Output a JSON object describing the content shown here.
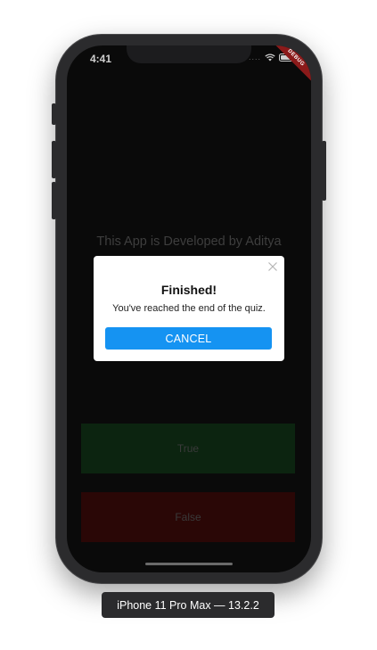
{
  "status_bar": {
    "time": "4:41",
    "signal": "....",
    "debug_banner": "DEBUG"
  },
  "app": {
    "credit_text": "This App is Developed by Aditya",
    "true_button_label": "True",
    "false_button_label": "False"
  },
  "dialog": {
    "title": "Finished!",
    "message": "You've reached the end of the quiz.",
    "cancel_label": "CANCEL",
    "close_icon": "close-icon",
    "accent_color": "#1593f2"
  },
  "simulator": {
    "device_label": "iPhone 11 Pro Max — 13.2.2"
  },
  "colors": {
    "true_button_bg": "#0c2410",
    "false_button_bg": "#2a0706",
    "screen_bg": "#0a0a0a"
  }
}
